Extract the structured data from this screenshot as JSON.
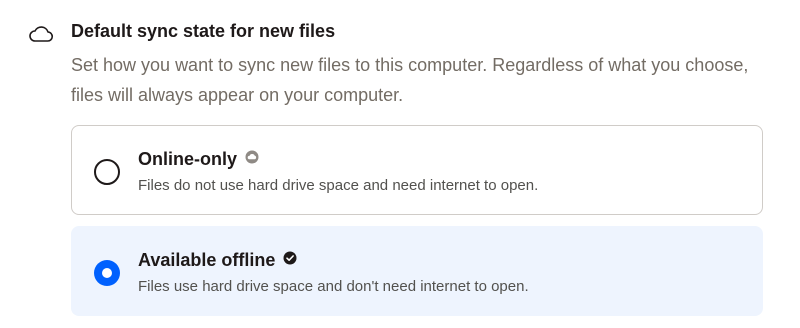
{
  "section": {
    "icon": "cloud-icon",
    "title": "Default sync state for new files",
    "description": "Set how you want to sync new files to this computer. Regardless of what you choose, files will always appear on your computer."
  },
  "options": [
    {
      "label": "Online-only",
      "description": "Files do not use hard drive space and need internet to open.",
      "status_icon": "online-only-cloud-icon",
      "selected": false
    },
    {
      "label": "Available offline",
      "description": "Files use hard drive space and don't need internet to open.",
      "status_icon": "available-offline-check-icon",
      "selected": true
    }
  ],
  "colors": {
    "accent": "#0061fe",
    "selected_background": "#eef4fe",
    "border": "#d0ccc8",
    "muted_text": "#736c64"
  }
}
